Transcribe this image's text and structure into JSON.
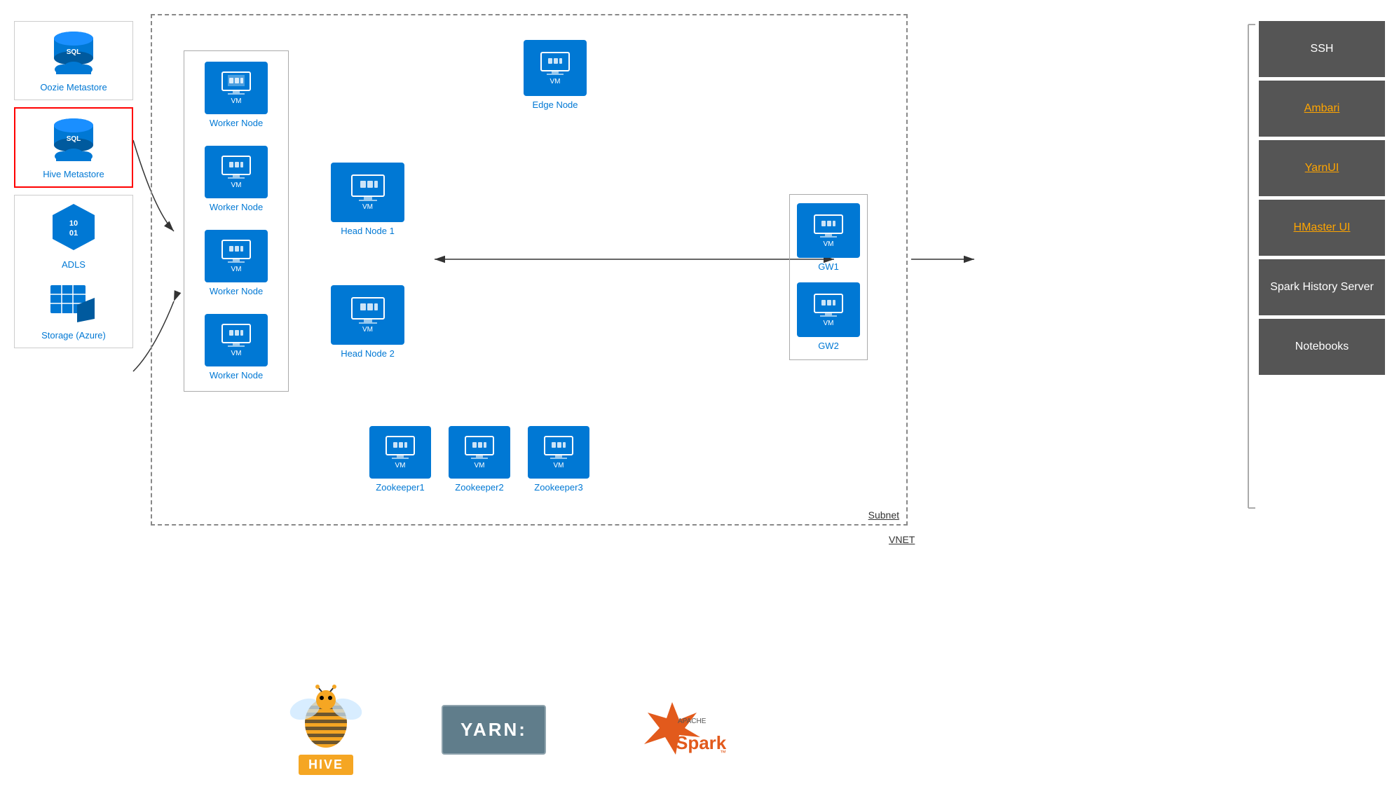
{
  "left": {
    "oozie_label": "Oozie Metastore",
    "hive_label": "Hive Metastore",
    "adls_label": "ADLS",
    "storage_label": "Storage (Azure)"
  },
  "nodes": {
    "worker_node_label": "Worker Node",
    "head_node1_label": "Head Node 1",
    "head_node2_label": "Head Node 2",
    "edge_node_label": "Edge Node",
    "gw1_label": "GW1",
    "gw2_label": "GW2",
    "vm_text": "VM",
    "zookeeper_labels": [
      "Zookeeper1",
      "Zookeeper2",
      "Zookeeper3"
    ]
  },
  "labels": {
    "subnet": "Subnet",
    "vnet": "VNET"
  },
  "right_panel": {
    "items": [
      {
        "label": "SSH",
        "link": false
      },
      {
        "label": "Ambari",
        "link": true
      },
      {
        "label": "YarnUI",
        "link": true
      },
      {
        "label": "HMaster UI",
        "link": true
      },
      {
        "label": "Spark History\nServer",
        "link": false
      },
      {
        "label": "Notebooks",
        "link": false
      }
    ]
  },
  "bottom": {
    "hive_text": "HIVE",
    "yarn_text": "YARN:",
    "spark_text": "Spark",
    "apache_text": "APACHE"
  },
  "colors": {
    "blue": "#0078D4",
    "dark_btn": "#555555",
    "link_orange": "#FFA500"
  }
}
